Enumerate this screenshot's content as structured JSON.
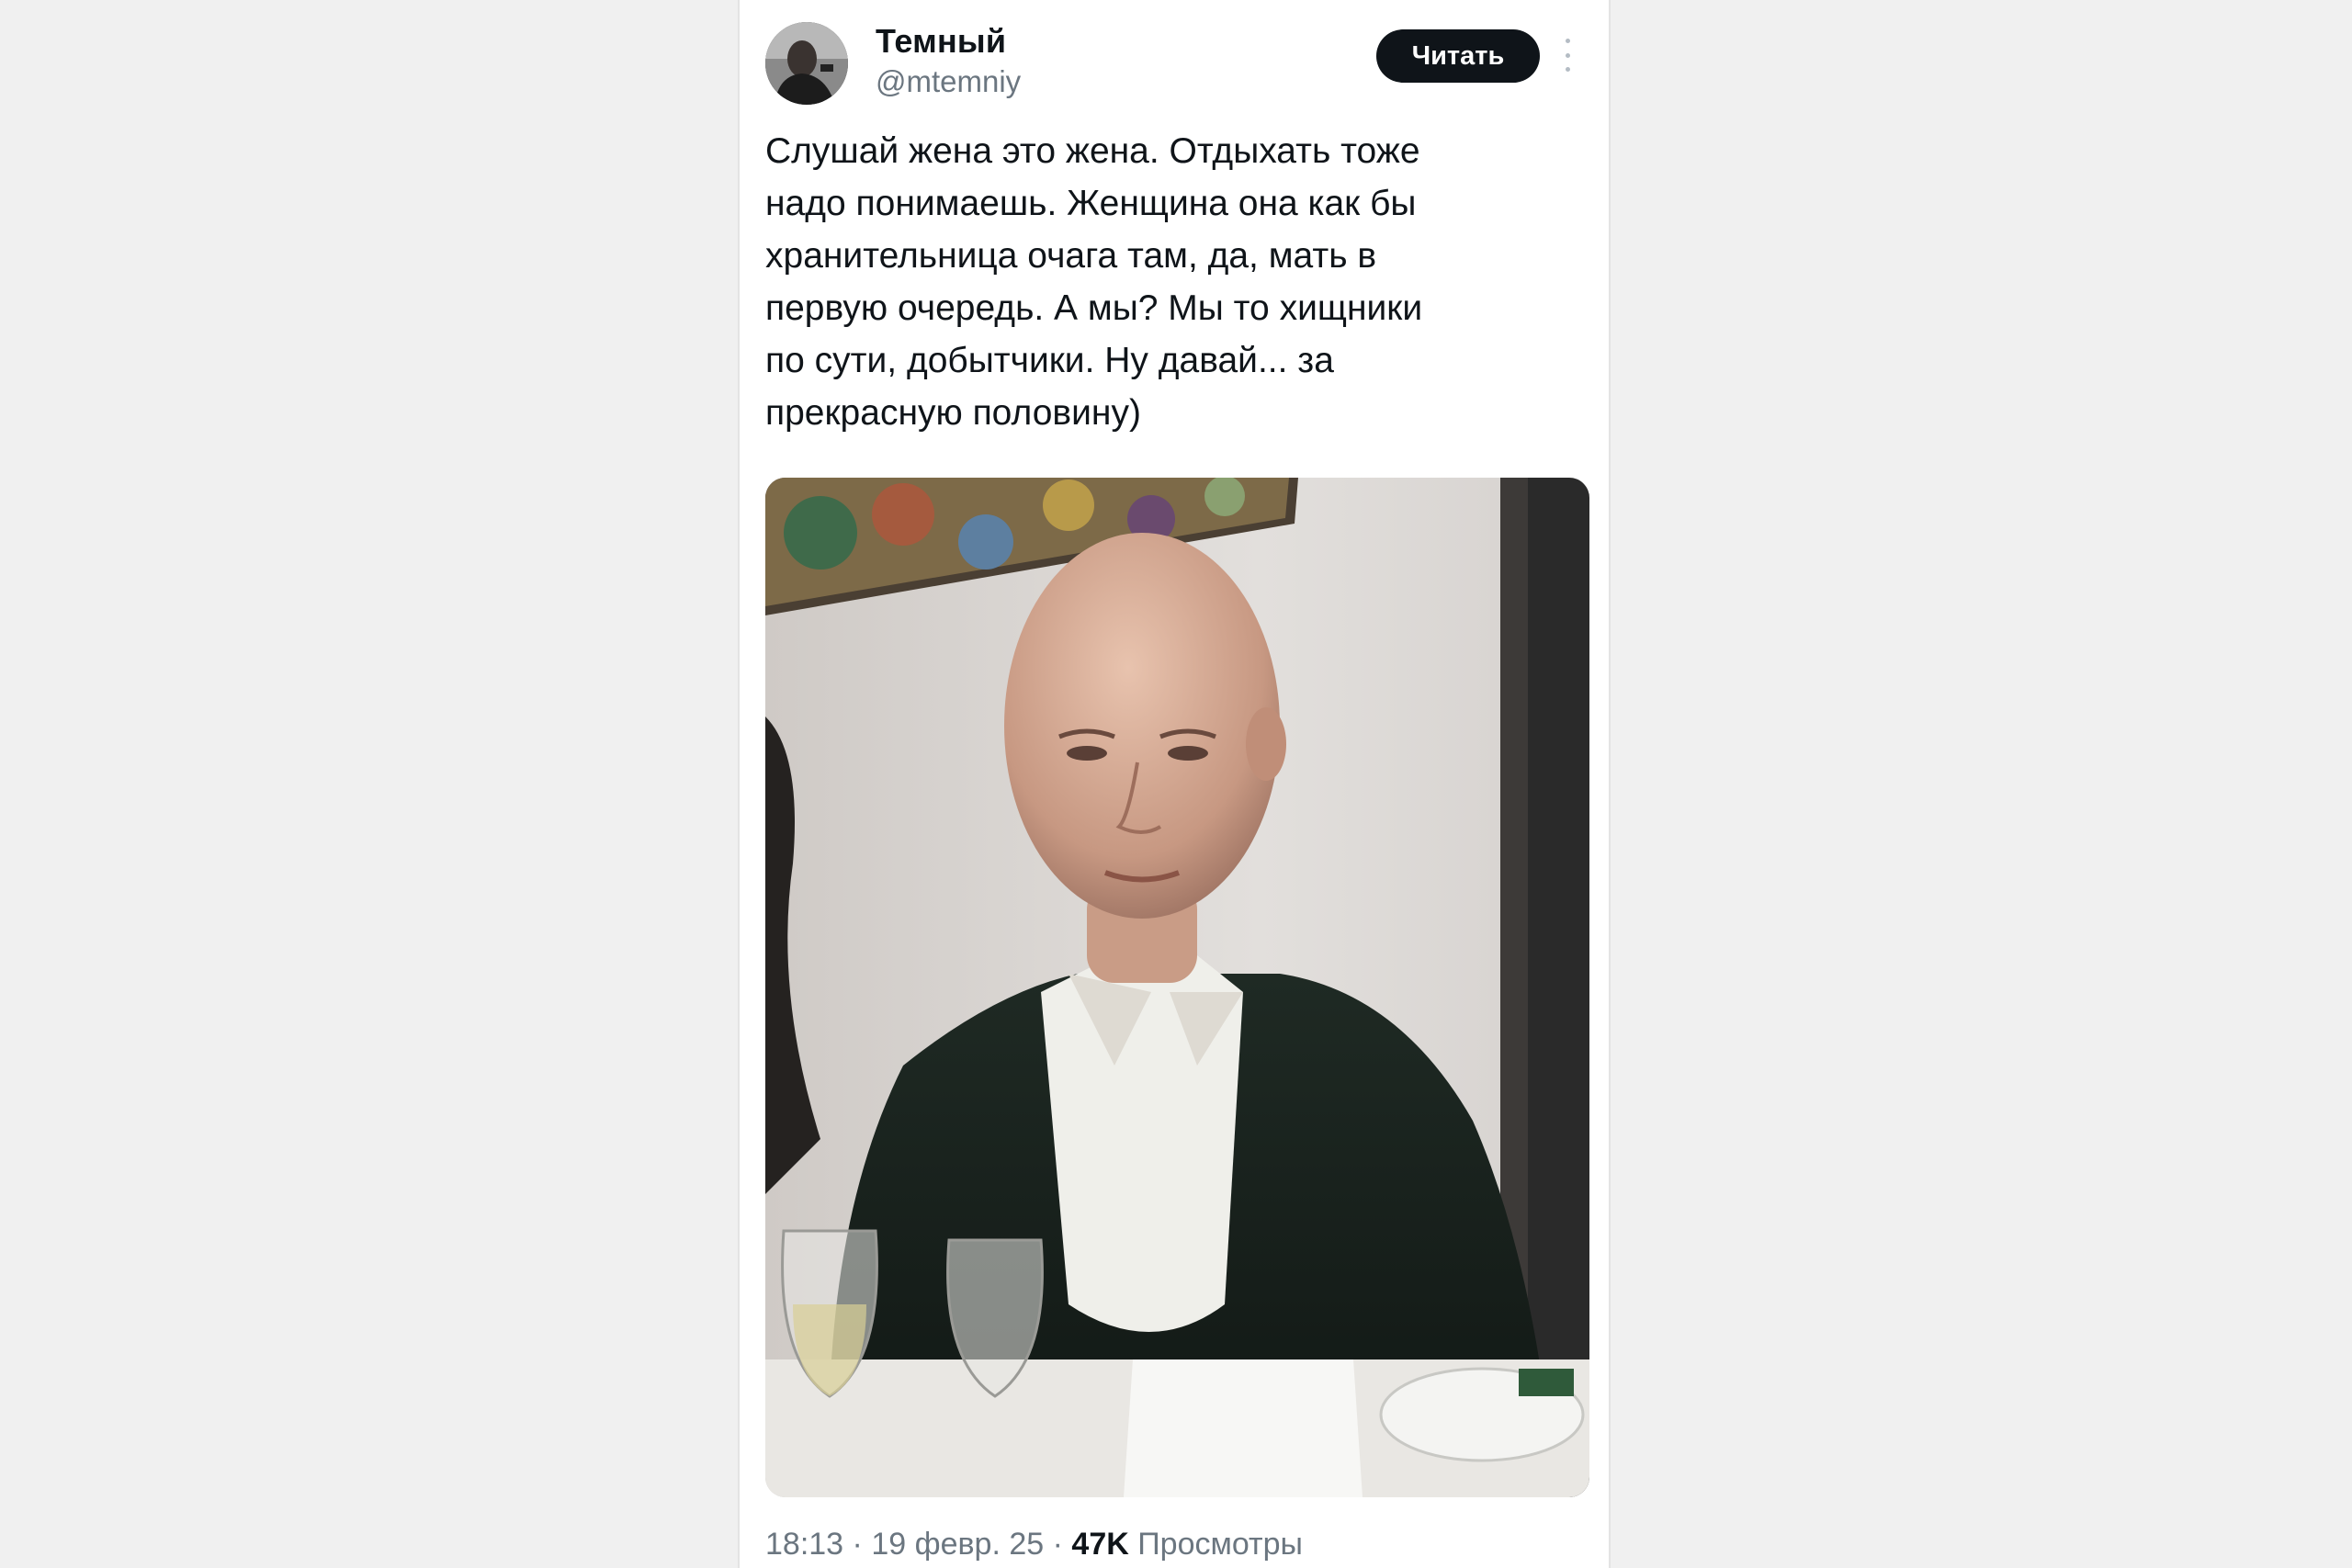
{
  "tweet": {
    "author": {
      "display_name": "Темный",
      "handle": "@mtemniy"
    },
    "follow_label": "Читать",
    "more_icon": "more-vertical-icon",
    "text": "Слушай жена это жена. Отдыхать тоже\nнадо понимаешь. Женщина она как бы\nхранительница очага там, да, мать в\nпервую очередь. А мы? Мы то хищники\nпо сути, добытчики. Ну давай... за\nпрекрасную половину)",
    "meta": {
      "time": "18:13",
      "separator": "·",
      "date": "19 февр. 25",
      "views_count": "47K",
      "views_label": "Просмотры"
    }
  },
  "colors": {
    "page_bg": "#f0f0f0",
    "card_bg": "#ffffff",
    "text_primary": "#0f1419",
    "text_secondary": "#6b7680",
    "button_bg": "#0f1419"
  }
}
